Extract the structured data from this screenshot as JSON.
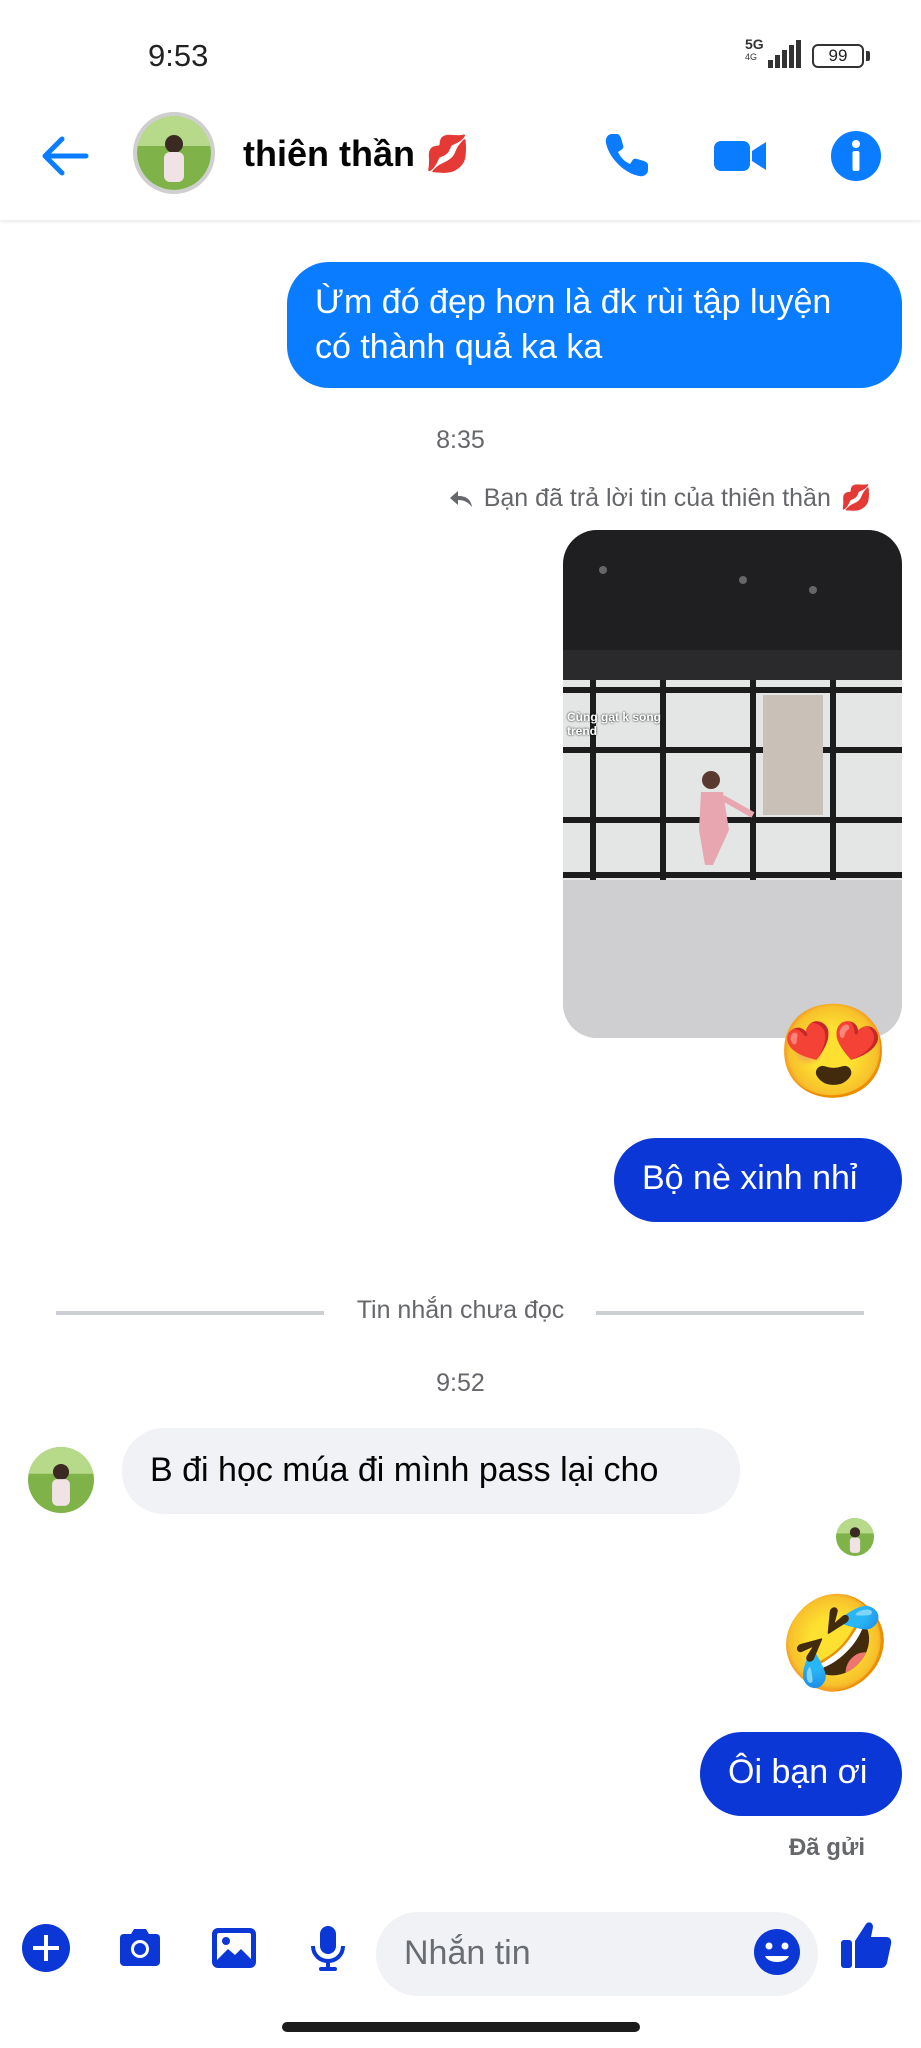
{
  "status": {
    "time": "9:53",
    "network_top": "5G",
    "network_bottom": "4G",
    "battery": "99"
  },
  "header": {
    "contact_name": "thiên thần",
    "name_emoji": "💋"
  },
  "messages": {
    "out1": "Ừm đó đẹp hơn là đk rùi tập luyện có thành quả ka ka",
    "time1": "8:35",
    "reply_notice": "Bạn đã trả lời tin của thiên thần",
    "reply_emoji": "💋",
    "media_caption": "Cùng gạt k song trend",
    "reaction1": "😍",
    "out2": "Bộ nè xinh nhỉ",
    "unread_divider": "Tin nhắn chưa đọc",
    "time2": "9:52",
    "in1": "B đi học múa đi mình pass lại cho",
    "reaction2": "🤣",
    "out3": "Ôi bạn ơi",
    "sent_status": "Đã gửi"
  },
  "composer": {
    "placeholder": "Nhắn tin"
  },
  "colors": {
    "accent": "#0a7cff",
    "outgoing_dark": "#0b37d6",
    "incoming_bg": "#f0f2f5"
  },
  "icons": [
    "back-arrow-icon",
    "phone-icon",
    "video-call-icon",
    "info-icon",
    "plus-icon",
    "camera-icon",
    "gallery-icon",
    "microphone-icon",
    "emoji-icon",
    "thumbs-up-icon"
  ]
}
